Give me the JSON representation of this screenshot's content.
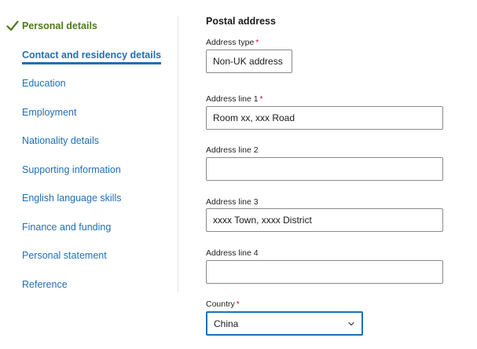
{
  "sidebar": {
    "items": [
      {
        "label": "Personal details",
        "state": "completed"
      },
      {
        "label": "Contact and residency details",
        "state": "active"
      },
      {
        "label": "Education",
        "state": "default"
      },
      {
        "label": "Employment",
        "state": "default"
      },
      {
        "label": "Nationality details",
        "state": "default"
      },
      {
        "label": "Supporting information",
        "state": "default"
      },
      {
        "label": "English language skills",
        "state": "default"
      },
      {
        "label": "Finance and funding",
        "state": "default"
      },
      {
        "label": "Personal statement",
        "state": "default"
      },
      {
        "label": "Reference",
        "state": "default"
      }
    ]
  },
  "form": {
    "section_title": "Postal address",
    "address_type": {
      "label": "Address type",
      "required_mark": "*",
      "value": "Non-UK address"
    },
    "address_line_1": {
      "label": "Address line 1",
      "required_mark": "*",
      "value": "Room xx, xxx Road"
    },
    "address_line_2": {
      "label": "Address line 2",
      "value": ""
    },
    "address_line_3": {
      "label": "Address line 3",
      "value": "xxxx Town, xxxx District"
    },
    "address_line_4": {
      "label": "Address line 4",
      "value": ""
    },
    "country": {
      "label": "Country",
      "required_mark": "*",
      "value": "China"
    }
  },
  "icons": {
    "completed": "check-icon",
    "select": "chevron-down-icon"
  },
  "colors": {
    "link": "#1f6fb5",
    "completed": "#4f7a1c",
    "required": "#c8102e",
    "focus_border": "#1f6fb5"
  }
}
